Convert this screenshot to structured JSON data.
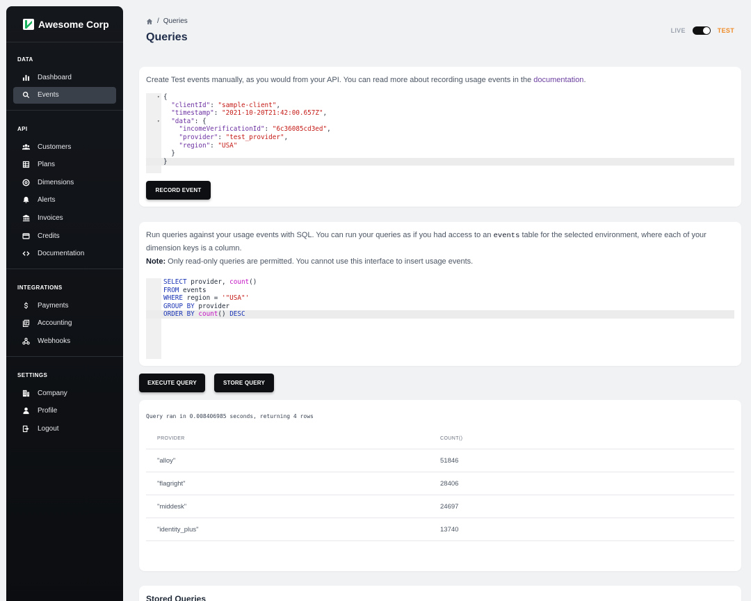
{
  "brand": {
    "name": "Awesome Corp"
  },
  "sidebar": {
    "sections": [
      {
        "title": "DATA",
        "items": [
          {
            "label": "Dashboard",
            "icon": "bar-chart-icon"
          },
          {
            "label": "Events",
            "icon": "search-icon",
            "active": true
          }
        ]
      },
      {
        "title": "API",
        "items": [
          {
            "label": "Customers",
            "icon": "users-icon"
          },
          {
            "label": "Plans",
            "icon": "table-icon"
          },
          {
            "label": "Dimensions",
            "icon": "target-icon"
          },
          {
            "label": "Alerts",
            "icon": "bell-icon"
          },
          {
            "label": "Invoices",
            "icon": "bank-icon"
          },
          {
            "label": "Credits",
            "icon": "wallet-icon"
          },
          {
            "label": "Documentation",
            "icon": "code-icon"
          }
        ]
      },
      {
        "title": "INTEGRATIONS",
        "items": [
          {
            "label": "Payments",
            "icon": "dollar-icon"
          },
          {
            "label": "Accounting",
            "icon": "ledger-icon"
          },
          {
            "label": "Webhooks",
            "icon": "webhook-icon"
          }
        ]
      },
      {
        "title": "SETTINGS",
        "items": [
          {
            "label": "Company",
            "icon": "building-icon"
          },
          {
            "label": "Profile",
            "icon": "person-icon"
          },
          {
            "label": "Logout",
            "icon": "logout-icon"
          }
        ]
      }
    ]
  },
  "header": {
    "breadcrumb_current": "Queries",
    "title": "Queries",
    "env_live": "LIVE",
    "env_test": "TEST",
    "env_selected": "TEST"
  },
  "record": {
    "description_prefix": "Create Test events manually, as you would from your API. You can read more about recording usage events in the ",
    "description_link": "documentation",
    "description_suffix": ".",
    "button": "RECORD EVENT"
  },
  "query": {
    "desc_1": "Run queries against your usage events with SQL. You can run your queries as if you had access to an ",
    "desc_code": "events",
    "desc_2": " table for the selected environment, where each of your dimension keys is a column.",
    "note_label": "Note:",
    "note_text": " Only read-only queries are permitted. You cannot use this interface to insert usage events.",
    "execute_button": "EXECUTE QUERY",
    "store_button": "STORE QUERY"
  },
  "results": {
    "message": "Query ran in 0.008406985 seconds, returning 4 rows",
    "columns": [
      "PROVIDER",
      "COUNT()"
    ],
    "rows": [
      {
        "provider": "\"alloy\"",
        "count": "51846"
      },
      {
        "provider": "\"flagright\"",
        "count": "28406"
      },
      {
        "provider": "\"middesk\"",
        "count": "24697"
      },
      {
        "provider": "\"identity_plus\"",
        "count": "13740"
      }
    ]
  },
  "stored": {
    "title": "Stored Queries"
  },
  "colors": {
    "accent_test": "#f08a24",
    "sidebar_bg": "#14171c",
    "button_bg": "#0d0f12",
    "link": "#6b3fa0"
  }
}
